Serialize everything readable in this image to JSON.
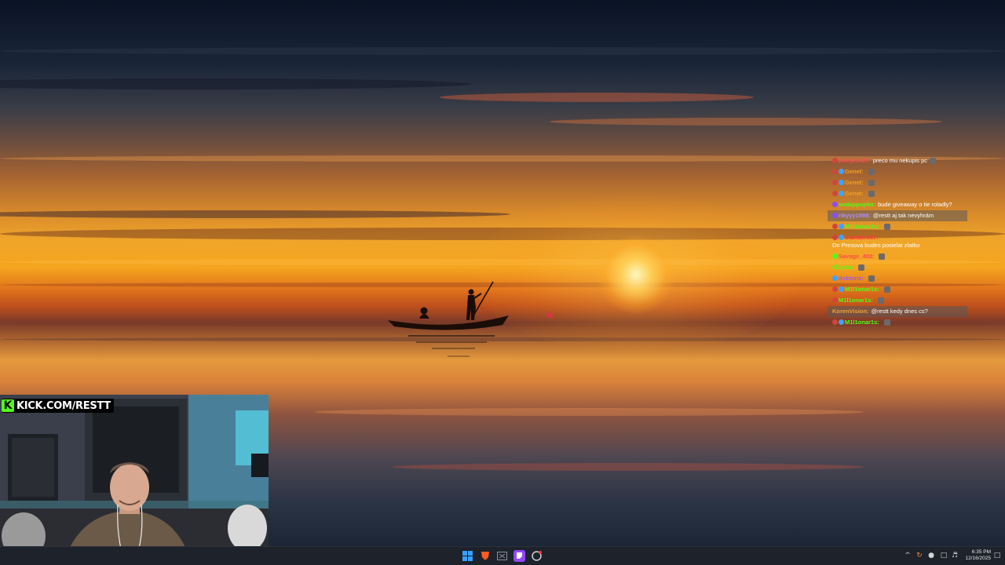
{
  "wallpaper": {
    "scene": "sunset-lake-boat"
  },
  "chat": {
    "messages": [
      {
        "user": "pelejko420:",
        "user_color": "#ff4d4d",
        "text": "preco mu nekupis pc",
        "badges": [
          "#d4443c"
        ],
        "highlight": false,
        "emote": true
      },
      {
        "user": "Genet:",
        "user_color": "#f0a020",
        "text": "",
        "badges": [
          "#d4443c",
          "#3fa2ff"
        ],
        "highlight": false,
        "emote": true
      },
      {
        "user": "Genet:",
        "user_color": "#f0a020",
        "text": "",
        "badges": [
          "#d4443c",
          "#3fa2ff"
        ],
        "highlight": false,
        "emote": true
      },
      {
        "user": "Genet:",
        "user_color": "#f0a020",
        "text": "",
        "badges": [
          "#d4443c",
          "#3fa2ff"
        ],
        "highlight": false,
        "emote": true
      },
      {
        "user": "sodappoplin:",
        "user_color": "#53fc18",
        "text": "bude giveaway o tie roladly?",
        "badges": [
          "#8a4dff"
        ],
        "highlight": false,
        "emote": false
      },
      {
        "user": "rikyyy1998:",
        "user_color": "#b28bff",
        "text": "@restt aj tak nevyhrám",
        "badges": [
          "#8a4dff"
        ],
        "highlight": true,
        "emote": false
      },
      {
        "user": "M1l1onar1s:",
        "user_color": "#53fc18",
        "text": "",
        "badges": [
          "#d4443c",
          "#3fa2ff"
        ],
        "highlight": false,
        "emote": true
      },
      {
        "user": "Stander007:",
        "user_color": "#ff3b3b",
        "text": "Do Presova budes posielat zlatko",
        "badges": [
          "#d4443c",
          "#3fa2ff"
        ],
        "highlight": false,
        "emote": false
      },
      {
        "user": "Savage_402:",
        "user_color": "#ff4d4d",
        "text": "",
        "badges": [
          "#53fc18"
        ],
        "highlight": false,
        "emote": true
      },
      {
        "user": "fil1p0o:",
        "user_color": "#53fc18",
        "text": "",
        "badges": [],
        "highlight": false,
        "emote": true
      },
      {
        "user": "doktoris:",
        "user_color": "#9b59ff",
        "text": "",
        "badges": [
          "#3fa2ff"
        ],
        "highlight": false,
        "emote": true
      },
      {
        "user": "M1l1onar1s:",
        "user_color": "#53fc18",
        "text": "",
        "badges": [
          "#d4443c",
          "#3fa2ff"
        ],
        "highlight": false,
        "emote": true
      },
      {
        "user": "M1l1onar1s:",
        "user_color": "#53fc18",
        "text": "",
        "badges": [
          "#d4443c"
        ],
        "highlight": false,
        "emote": true
      },
      {
        "user": "KorenVision:",
        "user_color": "#e8a23a",
        "text": "@restt kedy dnes cs?",
        "badges": [],
        "highlight": true,
        "emote": false
      },
      {
        "user": "M1l1onar1s:",
        "user_color": "#53fc18",
        "text": "",
        "badges": [
          "#d4443c",
          "#3fa2ff"
        ],
        "highlight": false,
        "emote": true
      }
    ]
  },
  "webcam": {
    "label": "KICK.COM/RESTT",
    "kick_letter": "K"
  },
  "taskbar": {
    "icons": [
      {
        "name": "windows-start-icon",
        "color": "#3aa0ff"
      },
      {
        "name": "brave-browser-icon",
        "color": "#ff5a1f"
      },
      {
        "name": "file-window-icon",
        "color": "#8a93a0"
      },
      {
        "name": "twitch-app-icon",
        "color": "#9146ff"
      },
      {
        "name": "obs-app-icon",
        "color": "#cfd3da"
      }
    ],
    "clock": {
      "time": "6:35 PM",
      "date": "12/16/2025"
    }
  }
}
